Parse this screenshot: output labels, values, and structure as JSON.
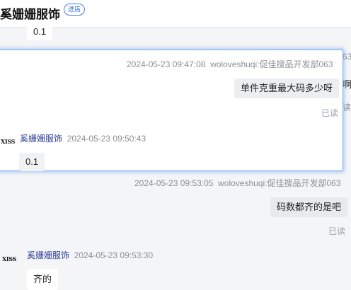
{
  "header": {
    "shop_name": "奚姗姗服饰",
    "enter_label": "进店"
  },
  "messages": [
    {
      "side": "seller",
      "text": "0.1"
    },
    {
      "side": "buyer",
      "time": "2024-05-23 09:47:08",
      "sender": "woloveshuqi:促佳搜品开发部063",
      "text": "单件克重最大码多少呀",
      "status": "已读"
    },
    {
      "side": "seller",
      "avatar": "XISS",
      "sender": "奚姗姗服饰",
      "time": "2024-05-23 09:50:43",
      "text": "0.1"
    },
    {
      "side": "buyer",
      "time": "2024-05-23 09:53:05",
      "sender": "woloveshuqi:促佳搜品开发部063",
      "text": "码数都齐的是吧",
      "status": "已读"
    },
    {
      "side": "seller",
      "avatar": "XISS",
      "sender": "奚姗姗服饰",
      "time": "2024-05-23 09:53:30",
      "text": "齐的"
    }
  ],
  "background_fragments": {
    "number": "63",
    "char1": "啊",
    "char2": "读"
  },
  "colors": {
    "highlight_border": "#7fb2f0",
    "badge": "#2f6bd8",
    "sender_name": "#2c3e9a"
  }
}
